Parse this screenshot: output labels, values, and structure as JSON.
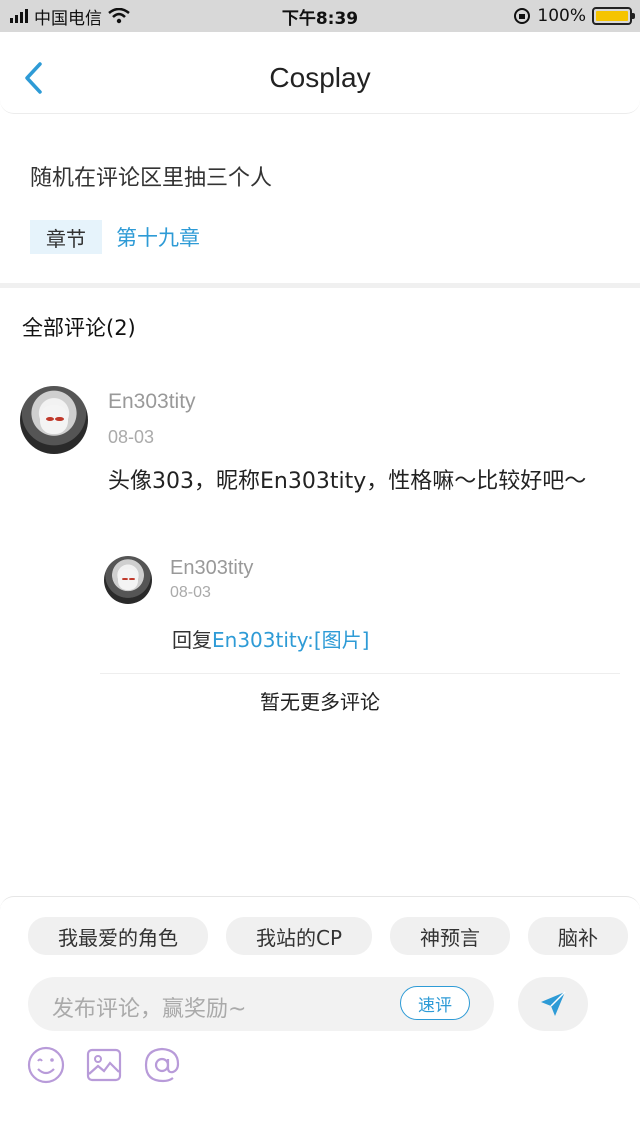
{
  "status_bar": {
    "carrier": "中国电信",
    "time": "下午8:39",
    "battery": "100%"
  },
  "header": {
    "title": "Cosplay"
  },
  "post": {
    "text": "随机在评论区里抽三个人",
    "chapter_tag": "章节",
    "chapter_link": "第十九章"
  },
  "comments": {
    "title": "全部评论(2)",
    "items": [
      {
        "name": "En303tity",
        "date": "08-03",
        "text": "头像303，昵称En303tity，性格嘛～比较好吧～"
      }
    ],
    "reply": {
      "name": "En303tity",
      "date": "08-03",
      "prefix": "回复",
      "target": "En303tity:[图片]"
    },
    "no_more": "暂无更多评论"
  },
  "composer": {
    "chips": [
      "我最爱的角色",
      "我站的CP",
      "神预言",
      "脑补"
    ],
    "placeholder": "发布评论，赢奖励~",
    "quick_review": "速评",
    "icons": [
      "emoji-icon",
      "image-icon",
      "at-icon"
    ],
    "accent_color": "#2e9bd6",
    "icon_color": "#b89bd9"
  }
}
